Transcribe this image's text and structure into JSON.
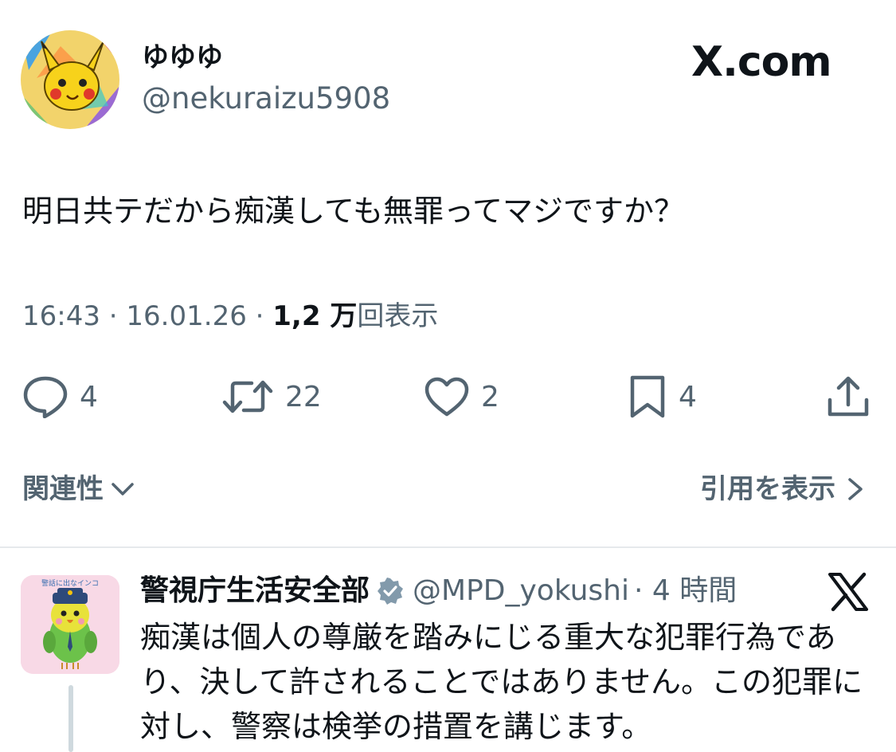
{
  "author": {
    "display_name": "ゆゆゆ",
    "handle": "@nekuraizu5908",
    "avatar_icon": "pikachu-avatar-icon"
  },
  "brand": {
    "label": "X.com"
  },
  "tweet": {
    "text": "明日共テだから痴漢しても無罪ってマジですか？",
    "time": "16:43",
    "date": "16.01.26",
    "views_count": "1,2 万",
    "views_label": "回表示"
  },
  "actions": {
    "reply_count": "4",
    "retweet_count": "22",
    "like_count": "2",
    "bookmark_count": "4"
  },
  "links": {
    "related_label": "関連性",
    "quotes_label": "引用を表示"
  },
  "reply": {
    "display_name": "警視庁生活安全部",
    "verified_icon": "verified-badge-icon",
    "handle": "@MPD_yokushi",
    "time": "· 4 時間",
    "text": "痴漢は個人の尊厳を踏みにじる重大な犯罪行為であり、決して許されることではありません。この犯罪に対し、警察は検挙の措置を講じます。",
    "avatar_caption": "警話に出なインコ"
  },
  "colors": {
    "text": "#0f1419",
    "secondary": "#536471",
    "divider": "#e6e9ec",
    "verified": "#829aab",
    "avatar_bg": "#f8d9e6"
  }
}
